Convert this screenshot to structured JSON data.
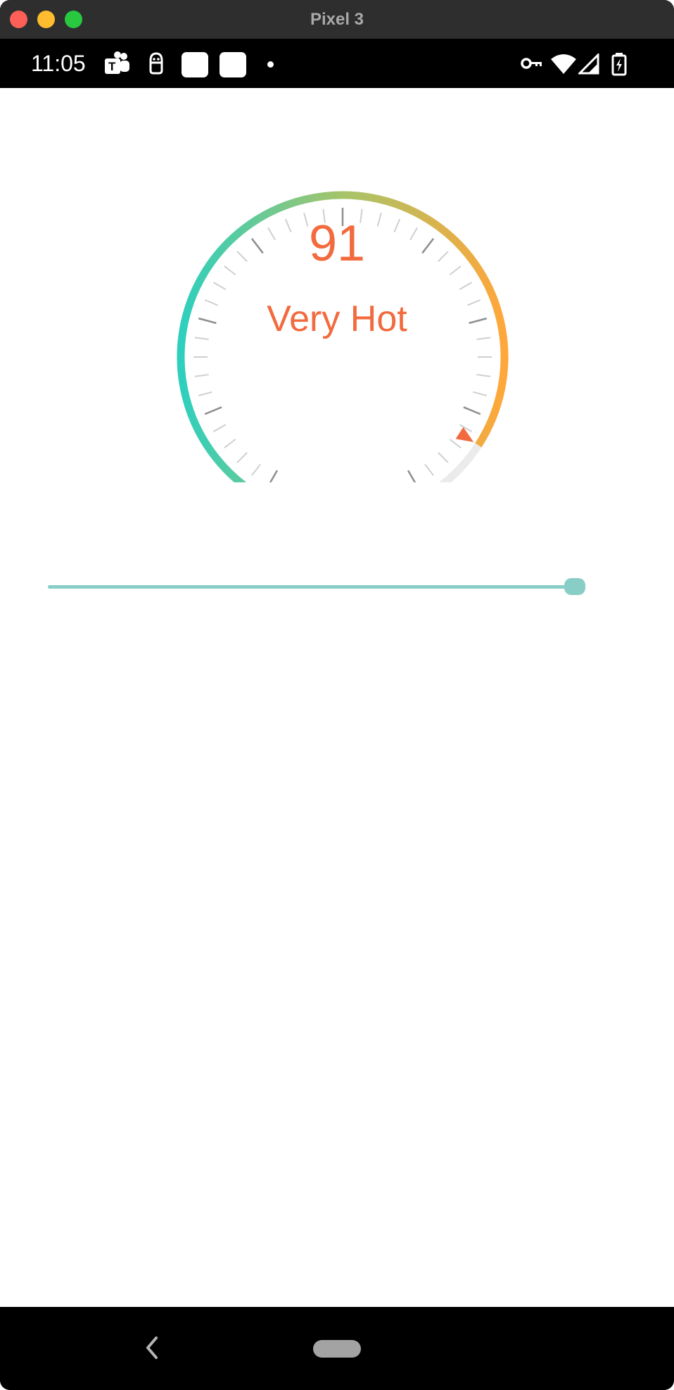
{
  "window": {
    "title": "Pixel 3",
    "buttons": [
      "close",
      "minimize",
      "maximize"
    ]
  },
  "status_bar": {
    "time": "11:05",
    "left_icons": [
      "teams-icon",
      "app-robot-icon",
      "app-placeholder-icon",
      "app-placeholder-icon",
      "notification-dot-icon"
    ],
    "right_icons": [
      "vpn-key-icon",
      "wifi-icon",
      "cell-signal-icon",
      "battery-charging-icon"
    ]
  },
  "gauge": {
    "value": "91",
    "label": "Very Hot",
    "level_fraction": 0.91,
    "colors": {
      "start": "#2fcfbd",
      "mid": "#a6c46a",
      "end": "#fea73a",
      "track": "#ebebeb",
      "pointer": "#f26a3e",
      "text": "#f26a3e"
    }
  },
  "slider": {
    "value_fraction": 1.0,
    "color": "#88cdc6"
  },
  "nav_bar": {
    "items": [
      "back-icon",
      "home-pill"
    ]
  }
}
